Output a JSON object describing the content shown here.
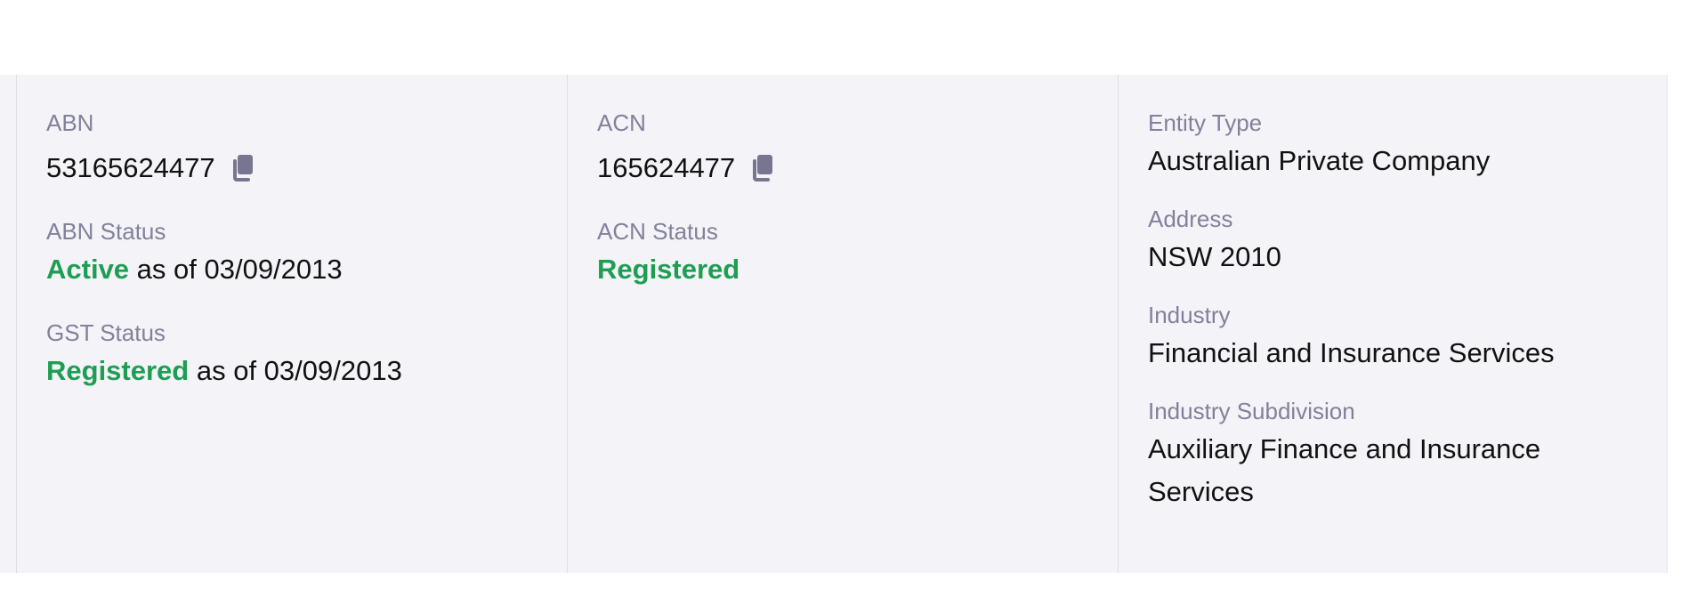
{
  "colors": {
    "panel_bg": "#f3f3f8",
    "label": "#82819a",
    "value": "#111111",
    "status_green": "#1e9e52",
    "icon": "#77758f"
  },
  "abn": {
    "label": "ABN",
    "value": "53165624477",
    "copy_icon": "copy-icon"
  },
  "abn_status": {
    "label": "ABN Status",
    "status": "Active",
    "suffix": " as of 03/09/2013"
  },
  "gst_status": {
    "label": "GST Status",
    "status": "Registered",
    "suffix": " as of 03/09/2013"
  },
  "acn": {
    "label": "ACN",
    "value": "165624477",
    "copy_icon": "copy-icon"
  },
  "acn_status": {
    "label": "ACN Status",
    "status": "Registered"
  },
  "entity_type": {
    "label": "Entity Type",
    "value": "Australian Private Company"
  },
  "address": {
    "label": "Address",
    "value": "NSW 2010"
  },
  "industry": {
    "label": "Industry",
    "value": "Financial and Insurance Services"
  },
  "industry_subdivision": {
    "label": "Industry Subdivision",
    "value": "Auxiliary Finance and Insurance Services"
  }
}
